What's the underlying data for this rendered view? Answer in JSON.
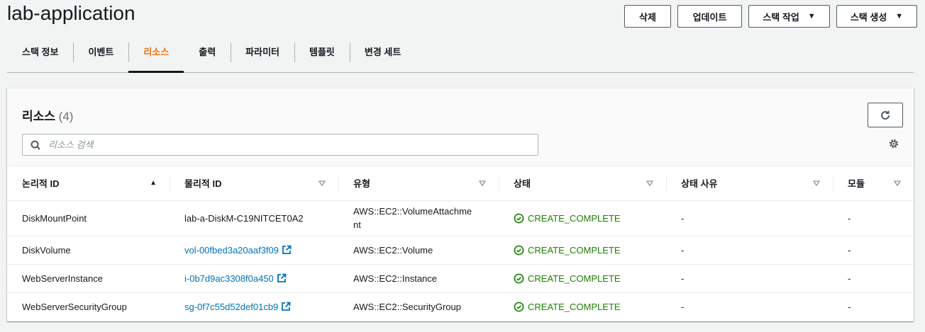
{
  "page": {
    "title": "lab-application"
  },
  "actions": {
    "delete": "삭제",
    "update": "업데이트",
    "stack_actions": "스택 작업",
    "create_stack": "스택 생성"
  },
  "tabs": [
    {
      "label": "스택 정보"
    },
    {
      "label": "이벤트"
    },
    {
      "label": "리소스",
      "active": true
    },
    {
      "label": "출력"
    },
    {
      "label": "파라미터"
    },
    {
      "label": "템플릿"
    },
    {
      "label": "변경 세트"
    }
  ],
  "panel": {
    "title": "리소스",
    "count": "(4)",
    "search_placeholder": "리소스 검색"
  },
  "table": {
    "columns": [
      "논리적 ID",
      "물리적 ID",
      "유형",
      "상태",
      "상태 사유",
      "모듈"
    ],
    "rows": [
      {
        "logical_id": "DiskMountPoint",
        "physical_id": "lab-a-DiskM-C19NITCET0A2",
        "physical_link": false,
        "type_line1": "AWS::EC2::VolumeAttachme",
        "type_line2": "nt",
        "status": "CREATE_COMPLETE",
        "reason": "-",
        "module": "-"
      },
      {
        "logical_id": "DiskVolume",
        "physical_id": "vol-00fbed3a20aaf3f09",
        "physical_link": true,
        "type": "AWS::EC2::Volume",
        "status": "CREATE_COMPLETE",
        "reason": "-",
        "module": "-"
      },
      {
        "logical_id": "WebServerInstance",
        "physical_id": "i-0b7d9ac3308f0a450",
        "physical_link": true,
        "type": "AWS::EC2::Instance",
        "status": "CREATE_COMPLETE",
        "reason": "-",
        "module": "-"
      },
      {
        "logical_id": "WebServerSecurityGroup",
        "physical_id": "sg-0f7c55d52def01cb9",
        "physical_link": true,
        "type": "AWS::EC2::SecurityGroup",
        "status": "CREATE_COMPLETE",
        "reason": "-",
        "module": "-"
      }
    ]
  },
  "colors": {
    "accent": "#ec7211",
    "link": "#0073bb",
    "success": "#1d8102"
  },
  "icons": [
    "search-icon",
    "refresh-icon",
    "settings-gear-icon",
    "sort-ascending-icon",
    "sort-icon",
    "external-link-icon",
    "success-check-icon",
    "caret-down-icon"
  ]
}
